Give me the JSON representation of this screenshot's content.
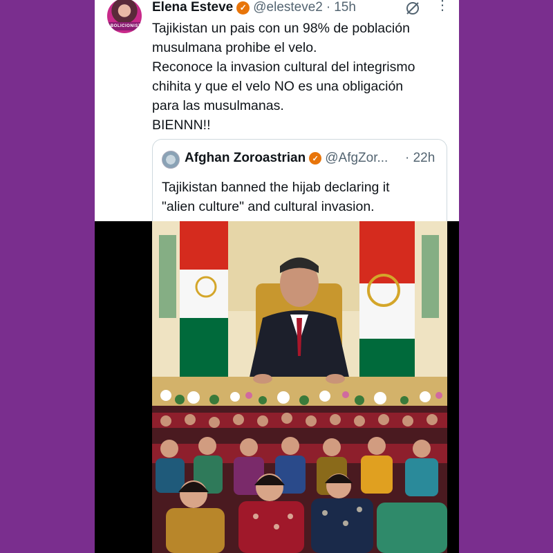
{
  "tweet": {
    "author_name": "Elena Esteve",
    "handle": "@elesteve2",
    "separator": "·",
    "time": "15h",
    "avatar_band_text": "ABOLICIONISTA",
    "lines": [
      "Tajikistan un pais con un 98% de población",
      "musulmana prohibe el velo.",
      "Reconoce la invasion cultural del integrismo",
      "chihita y que el velo NO es una obligación",
      "para las musulmanas.",
      "BIENNN!!"
    ]
  },
  "quote": {
    "author_name": "Afghan Zoroastrian",
    "handle": "@AfgZor...",
    "time": "· 22h",
    "lines": [
      "Tajikistan banned the hijab declaring it",
      "\"alien culture\" and cultural invasion."
    ]
  },
  "colors": {
    "background": "#7a2e8e",
    "verified_badge": "#e8750a",
    "text_primary": "#0f1419",
    "text_secondary": "#536471"
  },
  "icons": {
    "verified": "verified-badge-icon",
    "grok": "grok-icon",
    "more": "more-options-icon"
  }
}
